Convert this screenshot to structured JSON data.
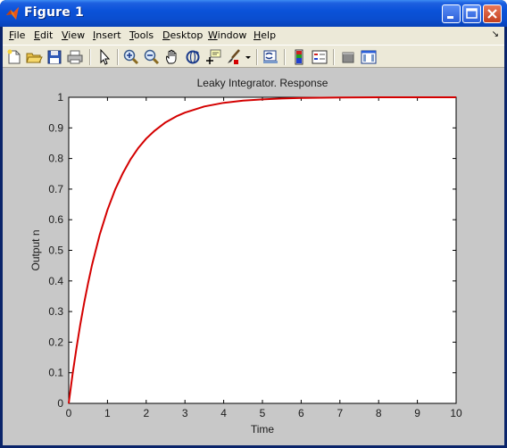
{
  "window": {
    "title": "Figure 1"
  },
  "menu": {
    "file": {
      "accel": "F",
      "rest": "ile"
    },
    "edit": {
      "accel": "E",
      "rest": "dit"
    },
    "view": {
      "accel": "V",
      "rest": "iew"
    },
    "insert": {
      "accel": "I",
      "rest": "nsert"
    },
    "tools": {
      "accel": "T",
      "rest": "ools"
    },
    "desktop": {
      "accel": "D",
      "rest": "esktop"
    },
    "window": {
      "accel": "W",
      "rest": "indow"
    },
    "help": {
      "accel": "H",
      "rest": "elp"
    }
  },
  "toolbar": {
    "icons": [
      "new-figure-icon",
      "open-file-icon",
      "save-icon",
      "print-icon",
      "edit-plot-arrow-icon",
      "zoom-in-icon",
      "zoom-out-icon",
      "pan-hand-icon",
      "rotate-3d-icon",
      "data-cursor-icon",
      "brush-icon",
      "brush-dropdown-icon",
      "link-plot-icon",
      "colorbar-icon",
      "legend-icon",
      "hide-plot-tools-icon",
      "show-plot-tools-icon"
    ]
  },
  "colors": {
    "line": "#D40000",
    "figure_bg": "#C8C8C8",
    "axes_bg": "#FFFFFF",
    "title_bar": "#0A52D9"
  },
  "chart_data": {
    "type": "line",
    "title": "Leaky Integrator. Response",
    "xlabel": "Time",
    "ylabel": "Output n",
    "xlim": [
      0,
      10
    ],
    "ylim": [
      0,
      1
    ],
    "xticks": [
      "0",
      "1",
      "2",
      "3",
      "4",
      "5",
      "6",
      "7",
      "8",
      "9",
      "10"
    ],
    "yticks": [
      "0",
      "0.1",
      "0.2",
      "0.3",
      "0.4",
      "0.5",
      "0.6",
      "0.7",
      "0.8",
      "0.9",
      "1"
    ],
    "grid": false,
    "series": [
      {
        "color": "#D40000",
        "x": [
          0,
          0.1,
          0.2,
          0.3,
          0.4,
          0.5,
          0.6,
          0.8,
          1.0,
          1.2,
          1.4,
          1.6,
          1.8,
          2.0,
          2.2,
          2.5,
          2.8,
          3.0,
          3.5,
          4.0,
          4.5,
          5.0,
          5.5,
          6.0,
          7.0,
          8.0,
          9.0,
          10.0
        ],
        "y": [
          0,
          0.095,
          0.181,
          0.259,
          0.33,
          0.393,
          0.451,
          0.551,
          0.632,
          0.699,
          0.753,
          0.798,
          0.835,
          0.865,
          0.889,
          0.918,
          0.939,
          0.95,
          0.97,
          0.982,
          0.989,
          0.993,
          0.996,
          0.998,
          0.999,
          1.0,
          1.0,
          1.0
        ]
      }
    ]
  }
}
